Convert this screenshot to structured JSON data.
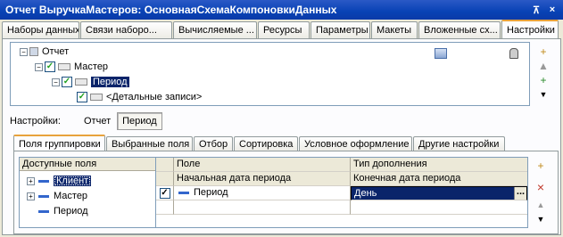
{
  "window": {
    "title": "Отчет ВыручкаМастеров: ОсновнаяСхемаКомпоновкиДанных",
    "pin_glyph": "⊼",
    "close_glyph": "×"
  },
  "top_tabs": [
    {
      "label": "Наборы данных"
    },
    {
      "label": "Связи наборо..."
    },
    {
      "label": "Вычисляемые ..."
    },
    {
      "label": "Ресурсы"
    },
    {
      "label": "Параметры"
    },
    {
      "label": "Макеты"
    },
    {
      "label": "Вложенные сх..."
    },
    {
      "label": "Настройки"
    }
  ],
  "structure_tree": {
    "root": "Отчет",
    "master": "Мастер",
    "period": "Период",
    "details": "<Детальные записи>"
  },
  "settings": {
    "label": "Настройки:",
    "option_report": "Отчет",
    "option_period": "Период"
  },
  "inner_tabs": [
    {
      "label": "Поля группировки"
    },
    {
      "label": "Выбранные поля"
    },
    {
      "label": "Отбор"
    },
    {
      "label": "Сортировка"
    },
    {
      "label": "Условное оформление"
    },
    {
      "label": "Другие настройки"
    }
  ],
  "available_fields": {
    "header": "Доступные поля",
    "items": [
      {
        "label": "Клиент"
      },
      {
        "label": "Мастер"
      },
      {
        "label": "Период"
      }
    ]
  },
  "grouping_grid": {
    "columns": [
      "Поле",
      "Тип дополнения"
    ],
    "sub_columns": [
      "Начальная дата периода",
      "Конечная дата периода"
    ],
    "rows": [
      {
        "checked": true,
        "field": "Период",
        "addition_type": "День",
        "checkmark": "✓"
      }
    ]
  },
  "icons": {
    "check": "✓",
    "plus": "+",
    "minus": "−",
    "up": "▲",
    "down": "▼",
    "more": "»",
    "ellipsis": "..."
  }
}
